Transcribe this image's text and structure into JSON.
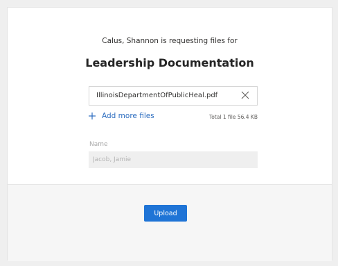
{
  "request": {
    "text": "Calus, Shannon is requesting files for",
    "title": "Leadership Documentation"
  },
  "file": {
    "name": "IllinoisDepartmentOfPublicHeal.pdf",
    "remove_icon": "close-icon"
  },
  "add_more": {
    "label": "Add more files",
    "icon": "plus-icon"
  },
  "total": "Total 1 file 56.4 KB",
  "name_field": {
    "label": "Name",
    "placeholder": "Jacob, Jamie"
  },
  "upload_button": {
    "label": "Upload"
  },
  "colors": {
    "accent": "#1f74d6",
    "link": "#2b6cbf"
  }
}
